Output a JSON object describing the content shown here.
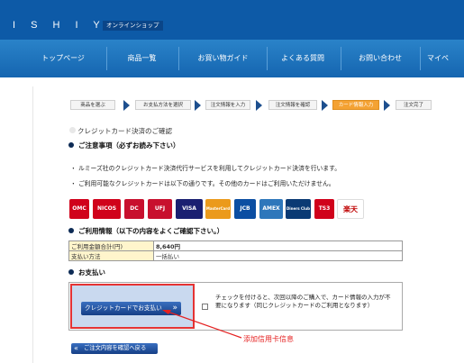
{
  "header": {
    "logo": "I S H I Y A",
    "shop_label": "オンラインショップ",
    "nav": [
      "トップページ",
      "商品一覧",
      "お買い物ガイド",
      "よくある質問",
      "お問い合わせ",
      "マイペ"
    ]
  },
  "steps": [
    {
      "label": "商品を選ぶ",
      "active": false
    },
    {
      "label": "お支払方法を選択",
      "active": false
    },
    {
      "label": "注文情報を入力",
      "active": false
    },
    {
      "label": "注文情報を確認",
      "active": false
    },
    {
      "label": "カード情報入力",
      "active": true
    },
    {
      "label": "注文完了",
      "active": false
    }
  ],
  "page_title": "クレジットカード決済のご確認",
  "notice_heading": "ご注意事項（必ずお読み下さい）",
  "notes": [
    "・ ルミーズ社のクレジットカード決済代行サービスを利用してクレジットカード決済を行います。",
    "・ ご利用可能なクレジットカードは以下の通りです。その他のカードはご利用いただけません。"
  ],
  "cards": [
    {
      "name": "OMC",
      "color": "#d0021b"
    },
    {
      "name": "NICOS",
      "color": "#d0021b"
    },
    {
      "name": "DC",
      "color": "#c8102e"
    },
    {
      "name": "UFJ",
      "color": "#c8102e"
    },
    {
      "name": "VISA",
      "color": "#1a1f71"
    },
    {
      "name": "MasterCard",
      "color": "#eb9a1c"
    },
    {
      "name": "JCB",
      "color": "#0b4ea2"
    },
    {
      "name": "AMEX",
      "color": "#2e77bb"
    },
    {
      "name": "Diners Club",
      "color": "#0a3a74"
    },
    {
      "name": "TS3",
      "color": "#d0021b"
    },
    {
      "name": "楽天",
      "color": "#ffffff"
    }
  ],
  "usage_heading": "ご利用情報（以下の内容をよくご確認下さい。）",
  "usage_rows": [
    {
      "key": "ご利用金額合計(円)",
      "value": "8,640円"
    },
    {
      "key": "支払い方法",
      "value": "一括払い"
    }
  ],
  "payment_heading": "お支払い",
  "payment": {
    "button_label": "クレジットカードでお支払い",
    "note": "チェックを付けると、次回以降のご購入で、カード情報の入力が不要になります（同じクレジットカードのご利用となります）"
  },
  "annotation": "添加信用卡信息",
  "back_button": "ご注文内容を確認へ戻る"
}
